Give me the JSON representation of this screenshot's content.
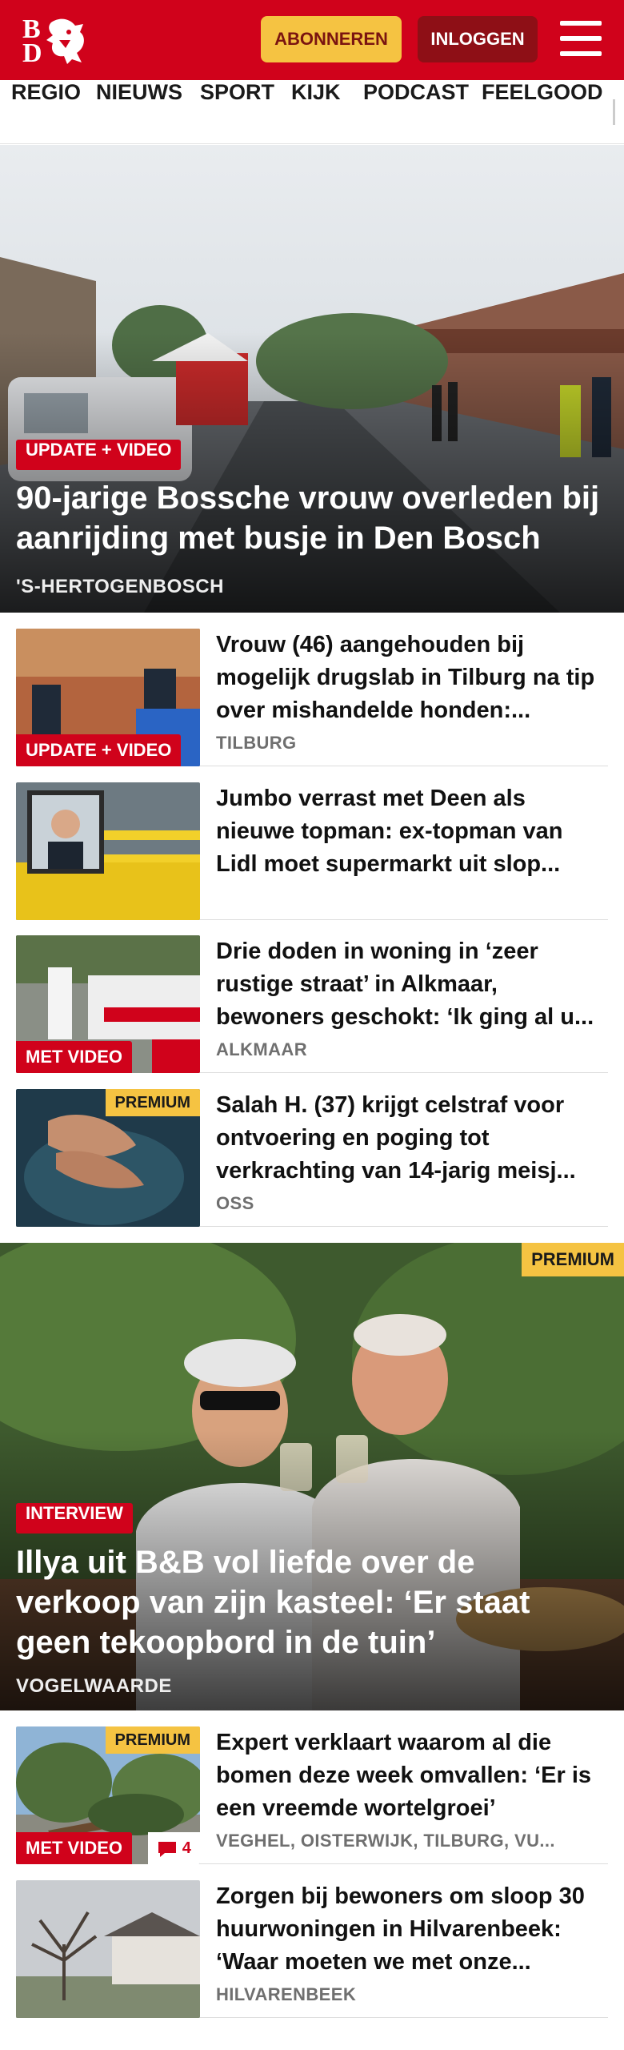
{
  "header": {
    "logo_top": "B",
    "logo_bottom": "D",
    "subscribe_label": "ABONNEREN",
    "login_label": "INLOGGEN",
    "menu_icon": "hamburger-icon",
    "brand_color": "#d0021b"
  },
  "nav": {
    "items": [
      "REGIO",
      "NIEUWS",
      "SPORT",
      "KIJK",
      "PODCAST",
      "FEELGOOD"
    ]
  },
  "hero1": {
    "tag": "UPDATE + VIDEO",
    "title": "90-jarige Bossche vrouw overleden bij aanrijding met busje in Den Bosch",
    "location": "'S-HERTOGENBOSCH"
  },
  "articles1": [
    {
      "tag": "UPDATE + VIDEO",
      "premium": "",
      "title": "Vrouw (46) aangehouden bij mogelijk drugslab in Tilburg na tip over mishandelde honden:...",
      "location": "TILBURG"
    },
    {
      "tag": "",
      "premium": "",
      "title": "Jumbo verrast met Deen als nieuwe topman: ex-topman van Lidl moet supermarkt uit slop...",
      "location": ""
    },
    {
      "tag": "MET VIDEO",
      "premium": "",
      "title": "Drie doden in woning in ‘zeer rustige straat’ in Alkmaar, bewoners geschokt: ‘Ik ging al u...",
      "location": "ALKMAAR"
    },
    {
      "tag": "",
      "premium": "PREMIUM",
      "title": "Salah H. (37) krijgt celstraf voor ontvoering en poging tot verkrachting van 14-jarig meisj...",
      "location": "OSS"
    }
  ],
  "hero2": {
    "premium": "PREMIUM",
    "tag": "INTERVIEW",
    "title": "Illya uit B&B vol liefde over de verkoop van zijn kasteel: ‘Er staat geen tekoopbord in de tuin’",
    "location": "VOGELWAARDE"
  },
  "articles2": [
    {
      "tag": "MET VIDEO",
      "premium": "PREMIUM",
      "comments": "4",
      "title": "Expert verklaart waarom al die bomen deze week omvallen: ‘Er is een vreemde wortelgroei’",
      "location": "VEGHEL, OISTERWIJK, TILBURG, VU..."
    },
    {
      "tag": "",
      "premium": "",
      "comments": "",
      "title": "Zorgen bij bewoners om sloop 30 huurwoningen in Hilvarenbeek: ‘Waar moeten we met onze...",
      "location": "HILVARENBEEK"
    }
  ]
}
